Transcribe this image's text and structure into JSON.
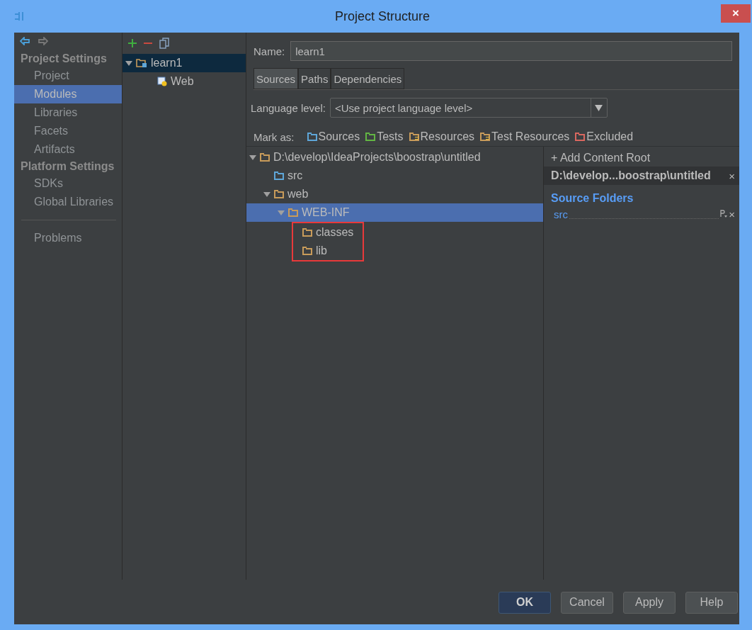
{
  "window": {
    "title": "Project Structure",
    "close": "×"
  },
  "sidebar": {
    "sections": [
      {
        "heading": "Project Settings",
        "items": [
          {
            "label": "Project",
            "selected": false
          },
          {
            "label": "Modules",
            "selected": true
          },
          {
            "label": "Libraries",
            "selected": false
          },
          {
            "label": "Facets",
            "selected": false
          },
          {
            "label": "Artifacts",
            "selected": false
          }
        ]
      },
      {
        "heading": "Platform Settings",
        "items": [
          {
            "label": "SDKs",
            "selected": false
          },
          {
            "label": "Global Libraries",
            "selected": false
          }
        ]
      }
    ],
    "bottom_items": [
      {
        "label": "Problems",
        "selected": false
      }
    ]
  },
  "module_tree": [
    {
      "label": "learn1",
      "kind": "module",
      "selected": true,
      "expanded": true,
      "children": [
        {
          "label": "Web",
          "kind": "web",
          "selected": false
        }
      ]
    }
  ],
  "name_field": {
    "label": "Name:",
    "value": "learn1"
  },
  "tabs": [
    {
      "label": "Sources",
      "selected": true
    },
    {
      "label": "Paths",
      "selected": false
    },
    {
      "label": "Dependencies",
      "selected": false
    }
  ],
  "language_level": {
    "label": "Language level:",
    "value": "<Use project language level>"
  },
  "mark_as": {
    "label": "Mark as:",
    "options": [
      {
        "label": "Sources",
        "kind": "plain",
        "color": "#5ea6d8"
      },
      {
        "label": "Tests",
        "kind": "plain",
        "color": "#62b543"
      },
      {
        "label": "Resources",
        "kind": "lined",
        "color": "#c89b5a"
      },
      {
        "label": "Test Resources",
        "kind": "lined",
        "color": "#c89b5a"
      },
      {
        "label": "Excluded",
        "kind": "plain",
        "color": "#d9675f"
      }
    ]
  },
  "content_tree": [
    {
      "label": "D:\\develop\\IdeaProjects\\boostrap\\untitled",
      "kind": "folder",
      "selected": false,
      "expanded": true,
      "children": [
        {
          "label": "src",
          "kind": "source",
          "selected": false
        },
        {
          "label": "web",
          "kind": "folder",
          "selected": false,
          "expanded": true,
          "children": [
            {
              "label": "WEB-INF",
              "kind": "folder",
              "selected": true,
              "expanded": true,
              "children_highlighted": true,
              "children": [
                {
                  "label": "classes",
                  "kind": "folder",
                  "selected": false
                },
                {
                  "label": "lib",
                  "kind": "folder",
                  "selected": false
                }
              ]
            }
          ]
        }
      ]
    }
  ],
  "content_root": {
    "add_label": "+ Add Content Root",
    "path": "D:\\develop...boostrap\\untitled",
    "remove": "×",
    "section": "Source Folders",
    "folders": [
      {
        "label": "src",
        "remove": "×"
      }
    ]
  },
  "buttons": [
    {
      "label": "OK",
      "kind": "default"
    },
    {
      "label": "Cancel",
      "kind": "normal"
    },
    {
      "label": "Apply",
      "kind": "normal"
    },
    {
      "label": "Help",
      "kind": "normal"
    }
  ]
}
